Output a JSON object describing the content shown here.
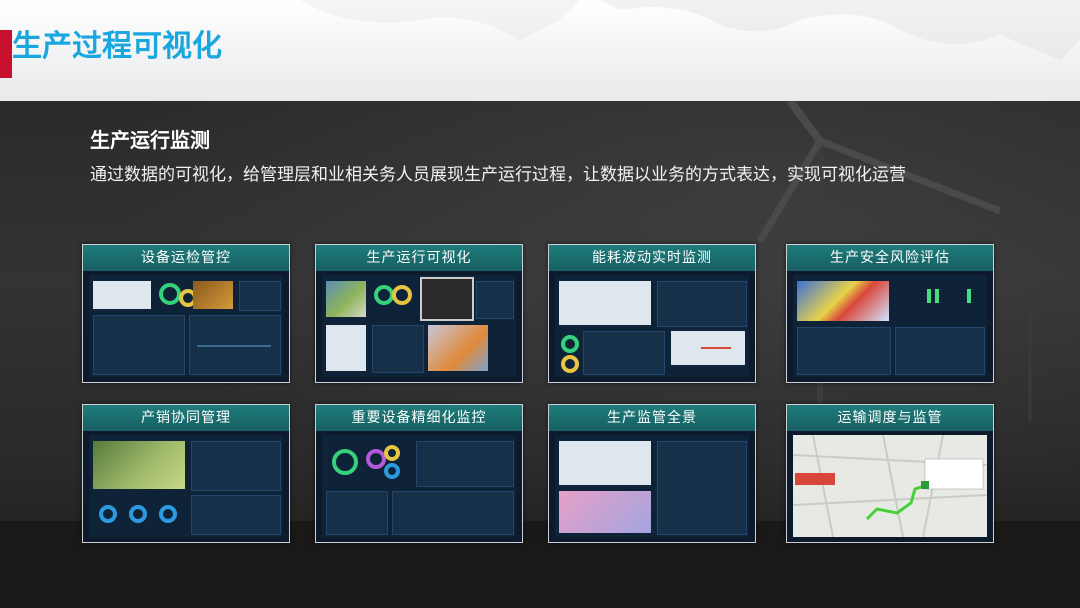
{
  "slide": {
    "title": "生产过程可视化"
  },
  "section": {
    "heading": "生产运行监测",
    "description": "通过数据的可视化，给管理层和业相关务人员展现生产运行过程，让数据以业务的方式表达，实现可视化运营"
  },
  "cards": [
    {
      "label": "设备运检管控"
    },
    {
      "label": "生产运行可视化"
    },
    {
      "label": "能耗波动实时监测"
    },
    {
      "label": "生产安全风险评估"
    },
    {
      "label": "产销协同管理"
    },
    {
      "label": "重要设备精细化监控"
    },
    {
      "label": "生产监管全景"
    },
    {
      "label": "运输调度与监管"
    }
  ],
  "colors": {
    "title_blue": "#1aa7e0",
    "accent_red": "#c8102e",
    "card_header": "#1e7d7a",
    "background_dark": "#2b2b2c"
  }
}
